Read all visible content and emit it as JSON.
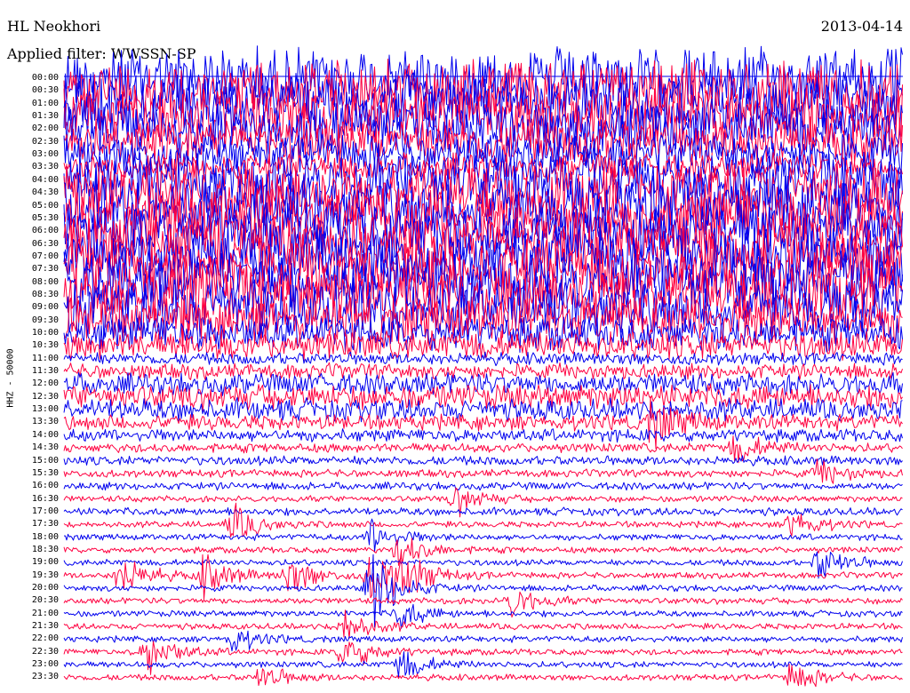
{
  "chart_data": {
    "type": "helicorder",
    "title": "HL Neokhori",
    "subtitle": "Applied filter: WWSSN-SP",
    "date": "2013-04-14",
    "channel_label": "HHZ - 50000",
    "row_labels": [
      "00:00",
      "00:30",
      "01:00",
      "01:30",
      "02:00",
      "02:30",
      "03:00",
      "03:30",
      "04:00",
      "04:30",
      "05:00",
      "05:30",
      "06:00",
      "06:30",
      "07:00",
      "07:30",
      "08:00",
      "08:30",
      "09:00",
      "09:30",
      "10:00",
      "10:30",
      "11:00",
      "11:30",
      "12:00",
      "12:30",
      "13:00",
      "13:30",
      "14:00",
      "14:30",
      "15:00",
      "15:30",
      "16:00",
      "16:30",
      "17:00",
      "17:30",
      "18:00",
      "18:30",
      "19:00",
      "19:30",
      "20:00",
      "20:30",
      "21:00",
      "21:30",
      "22:00",
      "22:30",
      "23:00",
      "23:30"
    ],
    "row_minutes": 30,
    "trace_colors": [
      "#0000ee",
      "#ff0040"
    ],
    "row_amplitude": [
      40,
      40,
      40,
      38,
      36,
      30,
      26,
      18,
      38,
      40,
      40,
      40,
      40,
      40,
      40,
      40,
      40,
      40,
      36,
      30,
      22,
      18,
      8,
      10,
      14,
      16,
      14,
      10,
      8,
      6,
      6,
      5,
      5,
      4,
      5,
      4,
      4,
      4,
      4,
      4,
      4,
      4,
      4,
      4,
      4,
      4,
      4,
      4
    ],
    "events": [
      {
        "row": 17,
        "minute": 4,
        "amp": 60
      },
      {
        "row": 17,
        "minute": 20,
        "amp": 40
      },
      {
        "row": 27,
        "minute": 21,
        "amp": 30
      },
      {
        "row": 29,
        "minute": 24,
        "amp": 20
      },
      {
        "row": 31,
        "minute": 27,
        "amp": 18
      },
      {
        "row": 33,
        "minute": 14,
        "amp": 20
      },
      {
        "row": 35,
        "minute": 6,
        "amp": 28
      },
      {
        "row": 35,
        "minute": 26,
        "amp": 22
      },
      {
        "row": 36,
        "minute": 11,
        "amp": 24
      },
      {
        "row": 37,
        "minute": 12,
        "amp": 26
      },
      {
        "row": 38,
        "minute": 27,
        "amp": 26
      },
      {
        "row": 39,
        "minute": 2,
        "amp": 30
      },
      {
        "row": 39,
        "minute": 5,
        "amp": 28
      },
      {
        "row": 39,
        "minute": 8,
        "amp": 28
      },
      {
        "row": 39,
        "minute": 12,
        "amp": 32
      },
      {
        "row": 39,
        "minute": 11,
        "amp": 40
      },
      {
        "row": 40,
        "minute": 11,
        "amp": 60
      },
      {
        "row": 41,
        "minute": 16,
        "amp": 22
      },
      {
        "row": 42,
        "minute": 12,
        "amp": 22
      },
      {
        "row": 43,
        "minute": 10,
        "amp": 26
      },
      {
        "row": 44,
        "minute": 6,
        "amp": 18
      },
      {
        "row": 45,
        "minute": 3,
        "amp": 30
      },
      {
        "row": 45,
        "minute": 10,
        "amp": 28
      },
      {
        "row": 46,
        "minute": 12,
        "amp": 22
      },
      {
        "row": 47,
        "minute": 26,
        "amp": 22
      },
      {
        "row": 47,
        "minute": 7,
        "amp": 18
      }
    ]
  }
}
